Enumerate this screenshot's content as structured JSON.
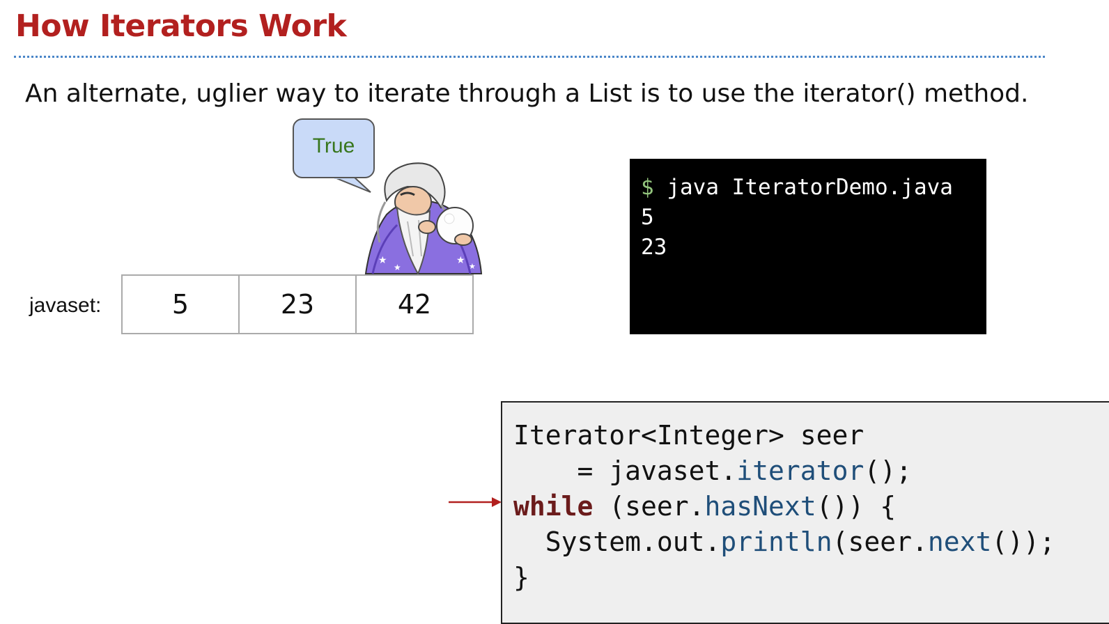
{
  "slide": {
    "title": "How Iterators Work",
    "subtitle": "An alternate, uglier way to iterate through a List is to use the iterator() method."
  },
  "bubble": {
    "text": "True"
  },
  "array": {
    "label": "javaset:",
    "cells": [
      "5",
      "23",
      "42"
    ]
  },
  "terminal": {
    "prompt": "$",
    "command": " java IteratorDemo.java",
    "output": [
      "5",
      "23"
    ]
  },
  "code": {
    "line1": "Iterator<Integer> seer",
    "line2_a": "    = javaset.",
    "line2_fn": "iterator",
    "line2_b": "();",
    "line3_kw": "while",
    "line3_a": " (seer.",
    "line3_fn": "hasNext",
    "line3_b": "()) {",
    "line4_a": "  System.out.",
    "line4_fn": "println",
    "line4_b": "(seer.",
    "line4_fn2": "next",
    "line4_c": "());",
    "line5": "}"
  },
  "colors": {
    "title": "#b2201f",
    "rule": "#4a86c8",
    "bubble": "#c9daf8",
    "bubble_text": "#38761d",
    "prompt": "#93c47d",
    "keyword": "#6b1b1b",
    "method": "#1f4e79",
    "pointer_arrow": "#b2201f"
  },
  "icons": {
    "wizard": "wizard-with-crystal-ball-icon",
    "pointer": "right-arrow-icon"
  }
}
